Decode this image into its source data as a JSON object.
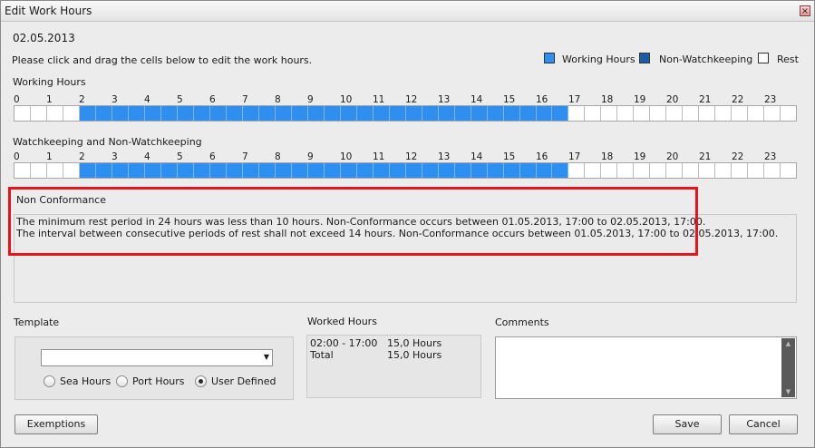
{
  "window": {
    "title": "Edit Work Hours",
    "close_glyph": "×"
  },
  "date": "02.05.2013",
  "instruction": "Please click and drag the cells below to edit the work hours.",
  "legend": [
    {
      "label": "Working Hours",
      "color": "#2e8ff0"
    },
    {
      "label": "Non-Watchkeeping",
      "color": "#1c5aa8"
    },
    {
      "label": "Rest",
      "color": "#ffffff"
    }
  ],
  "working_hours": {
    "label": "Working Hours",
    "hours": [
      "0",
      "1",
      "2",
      "3",
      "4",
      "5",
      "6",
      "7",
      "8",
      "9",
      "10",
      "11",
      "12",
      "13",
      "14",
      "15",
      "16",
      "17",
      "18",
      "19",
      "20",
      "21",
      "22",
      "23"
    ],
    "active_from": 2,
    "active_to": 17
  },
  "watchkeeping": {
    "label": "Watchkeeping and Non-Watchkeeping",
    "hours": [
      "0",
      "1",
      "2",
      "3",
      "4",
      "5",
      "6",
      "7",
      "8",
      "9",
      "10",
      "11",
      "12",
      "13",
      "14",
      "15",
      "16",
      "17",
      "18",
      "19",
      "20",
      "21",
      "22",
      "23"
    ],
    "active_from": 2,
    "active_to": 17
  },
  "non_conformance": {
    "label": "Non Conformance",
    "lines": [
      "The minimum rest period in 24 hours was less than 10 hours. Non-Conformance occurs between 01.05.2013, 17:00 to 02.05.2013, 17:00.",
      "The interval between consecutive periods of rest shall not exceed 14 hours. Non-Conformance occurs between 01.05.2013, 17:00 to 02.05.2013, 17:00."
    ]
  },
  "template": {
    "label": "Template",
    "selected": "",
    "options": [
      "Sea Hours",
      "Port Hours",
      "User Defined"
    ],
    "selected_option": "User Defined"
  },
  "worked_hours": {
    "label": "Worked Hours",
    "rows": [
      {
        "range": "02:00 - 17:00",
        "value": "15,0 Hours"
      },
      {
        "range": "Total",
        "value": "15,0 Hours"
      }
    ]
  },
  "comments": {
    "label": "Comments",
    "value": ""
  },
  "buttons": {
    "exemptions": "Exemptions",
    "save": "Save",
    "cancel": "Cancel"
  },
  "highlight_color": "#e8141b"
}
